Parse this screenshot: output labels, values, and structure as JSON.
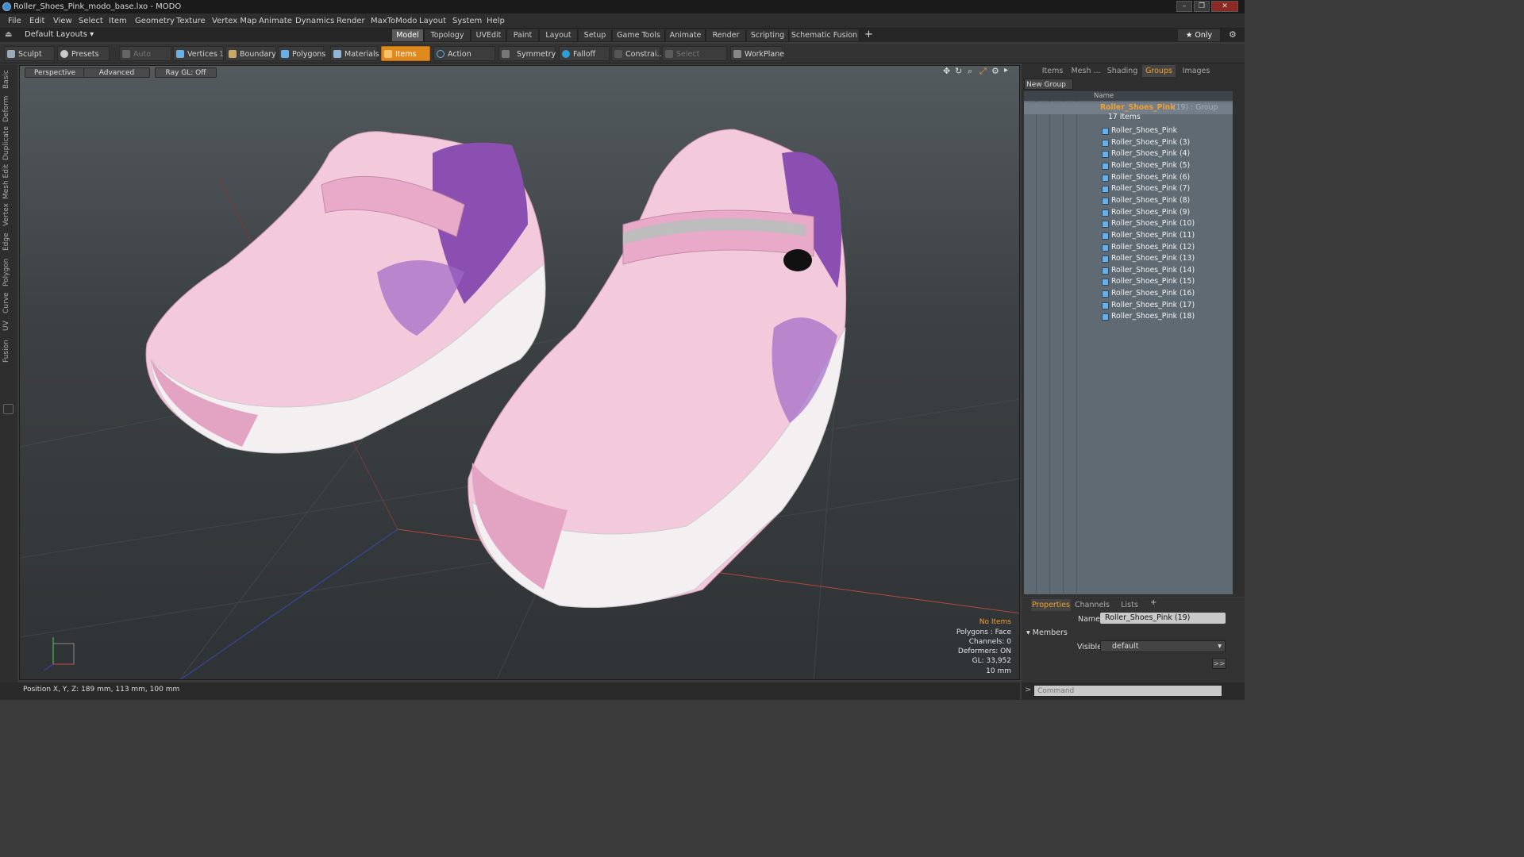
{
  "window": {
    "title": "Roller_Shoes_Pink_modo_base.lxo - MODO",
    "controls": [
      "–",
      "❐",
      "✕"
    ]
  },
  "menu": [
    "File",
    "Edit",
    "View",
    "Select",
    "Item",
    "Geometry",
    "Texture",
    "Vertex Map",
    "Animate",
    "Dynamics",
    "Render",
    "MaxToModo",
    "Layout",
    "System",
    "Help"
  ],
  "layoutbar": {
    "layouts_label": "Default Layouts ▾",
    "tabs": [
      "Model",
      "Topology",
      "UVEdit",
      "Paint",
      "Layout",
      "Setup",
      "Game Tools",
      "Animate",
      "Render",
      "Scripting",
      "Schematic Fusion"
    ],
    "active_tab": "Model",
    "add": "+",
    "only": "★ Only"
  },
  "toolbar": {
    "sculpt": "Sculpt",
    "presets": "Presets",
    "auto_select": "Auto Select",
    "vertices": "Vertices",
    "vertices_count": "1",
    "boundary": "Boundary",
    "polygons": "Polygons",
    "materials": "Materials",
    "items": "Items",
    "action_center": "Action Center",
    "symmetry": "Symmetry",
    "falloff": "Falloff",
    "constraints": "Constrai...",
    "select_through": "Select Through",
    "workplane": "WorkPlane"
  },
  "left_tabs": [
    "Basic",
    "Deform",
    "Duplicate",
    "Mesh Edit",
    "Vertex",
    "Edge",
    "Polygon",
    "Curve",
    "UV",
    "Fusion"
  ],
  "viewport": {
    "view": "Perspective",
    "shading": "Advanced",
    "raygl": "Ray GL: Off",
    "info": {
      "selection": "No Items",
      "polygons": "Polygons : Face",
      "channels": "Channels: 0",
      "deformers": "Deformers: ON",
      "gl": "GL: 33,952",
      "scale": "10 mm"
    },
    "colors": {
      "shoe": "#f3c9dc",
      "shoe_dark": "#e3a3c3",
      "accent": "#8a4fb0",
      "sole": "#f4f0f2"
    }
  },
  "status": "Position X, Y, Z:  189 mm, 113 mm, 100 mm",
  "right_panel": {
    "tabs": [
      "Items",
      "Mesh ...",
      "Shading",
      "Groups",
      "Images"
    ],
    "active_tab": "Groups",
    "new_group": "New Group",
    "column_name": "Name",
    "group": {
      "name": "Roller_Shoes_Pink",
      "suffix": "(19) : Group",
      "count": "17 Items"
    },
    "items": [
      "Roller_Shoes_Pink",
      "Roller_Shoes_Pink (3)",
      "Roller_Shoes_Pink (4)",
      "Roller_Shoes_Pink (5)",
      "Roller_Shoes_Pink (6)",
      "Roller_Shoes_Pink (7)",
      "Roller_Shoes_Pink (8)",
      "Roller_Shoes_Pink (9)",
      "Roller_Shoes_Pink (10)",
      "Roller_Shoes_Pink (11)",
      "Roller_Shoes_Pink (12)",
      "Roller_Shoes_Pink (13)",
      "Roller_Shoes_Pink (14)",
      "Roller_Shoes_Pink (15)",
      "Roller_Shoes_Pink (16)",
      "Roller_Shoes_Pink (17)",
      "Roller_Shoes_Pink (18)"
    ]
  },
  "properties": {
    "tabs": [
      "Properties",
      "Channels",
      "Lists"
    ],
    "add": "+",
    "name_label": "Name",
    "name_value": "Roller_Shoes_Pink (19)",
    "members": "Members",
    "visible_label": "Visible",
    "visible_value": "default",
    "more": ">>"
  },
  "command": {
    "prompt": ">",
    "placeholder": "Command"
  }
}
